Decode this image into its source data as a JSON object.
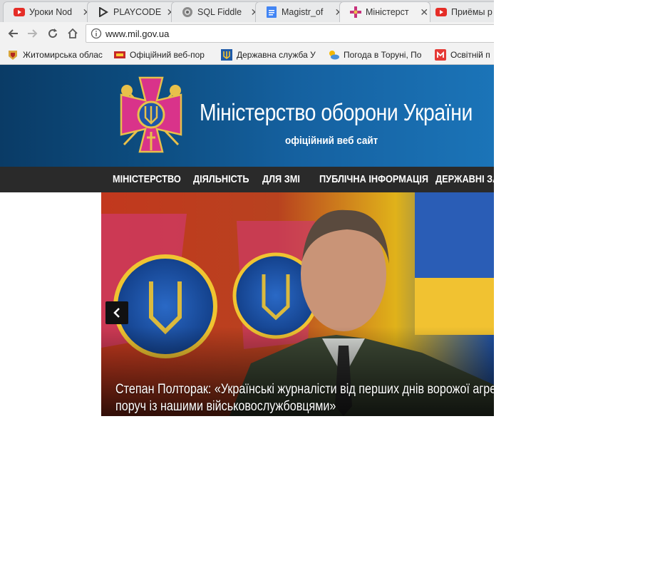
{
  "browser": {
    "tabs": [
      {
        "title": "Уроки Nod",
        "icon": "youtube-icon"
      },
      {
        "title": "PLAYCODE",
        "icon": "playcode-icon"
      },
      {
        "title": "SQL Fiddle",
        "icon": "sqlfiddle-icon"
      },
      {
        "title": "Magistr_of",
        "icon": "google-docs-icon"
      },
      {
        "title": "Міністерст",
        "icon": "ministry-emblem-icon"
      },
      {
        "title": "Приёмы р",
        "icon": "youtube-icon"
      }
    ],
    "close_symbol": "✕",
    "address_url": "www.mil.gov.ua",
    "bookmarks": [
      {
        "label": "Житомирська облас",
        "icon": "zhytomyr-icon"
      },
      {
        "label": "Офіційний веб-пор",
        "icon": "portal-icon"
      },
      {
        "label": "Державна служба У",
        "icon": "trident-icon"
      },
      {
        "label": "Погода в Торуні, По",
        "icon": "weather-icon"
      },
      {
        "label": "Освітній п",
        "icon": "education-icon"
      }
    ]
  },
  "site": {
    "title": "Міністерство оборони України",
    "subtitle": "офіційний веб сайт",
    "nav": [
      "МІНІСТЕРСТВО",
      "ДІЯЛЬНІСТЬ",
      "ДЛЯ ЗМІ",
      "ПУБЛІЧНА ІНФОРМАЦІЯ",
      "ДЕРЖАВНІ ЗАК"
    ],
    "hero": {
      "caption_line1": "Степан Полторак: «Українські журналісти від перших днів ворожої агрес",
      "caption_line2": "поруч із нашими військовослужбовцями»"
    },
    "colors": {
      "header_blue": "#0d4d80",
      "nav_dark": "#2a2a2a",
      "emblem_magenta": "#d9338a",
      "emblem_gold": "#e8c04a"
    }
  }
}
